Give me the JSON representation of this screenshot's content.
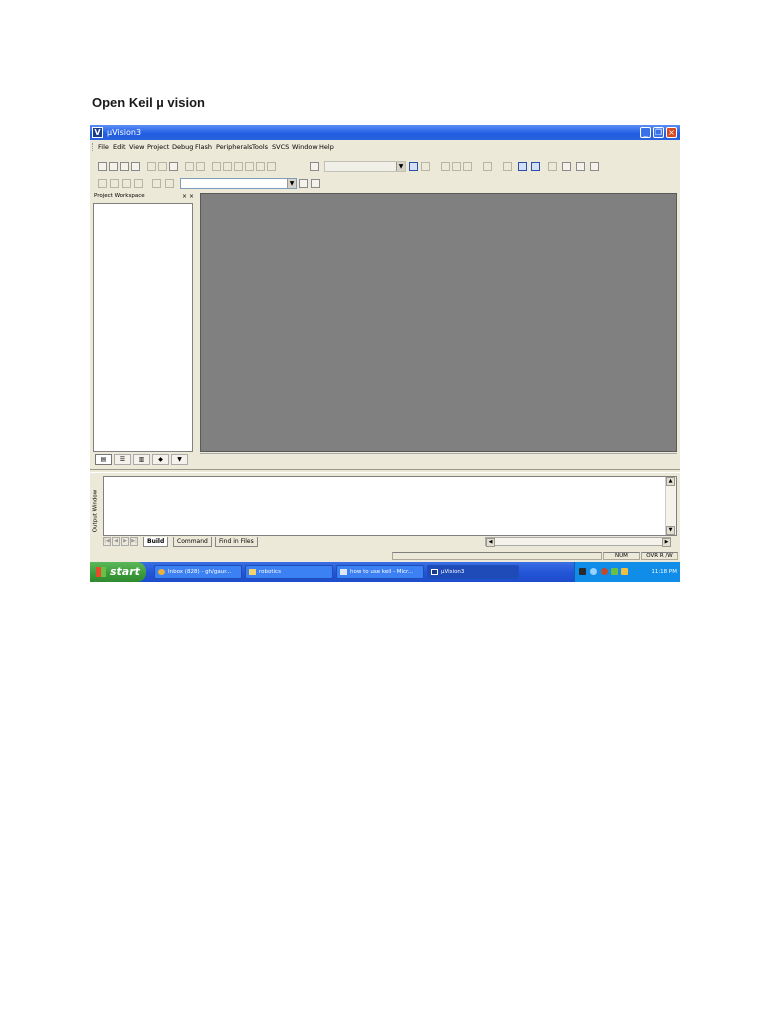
{
  "page": {
    "heading": "Open Keil µ vision"
  },
  "window": {
    "title": "µVision3",
    "icon_text": "V"
  },
  "menu": {
    "items": [
      "File",
      "Edit",
      "View",
      "Project",
      "Debug",
      "Flash",
      "Peripherals",
      "Tools",
      "SVCS",
      "Window",
      "Help"
    ]
  },
  "workspace": {
    "title": "Project Workspace",
    "close": "× ×"
  },
  "output": {
    "label": "Output Window",
    "tabs": {
      "build": "Build",
      "command": "Command",
      "find": "Find in Files"
    }
  },
  "status": {
    "num": "NUM",
    "ovr": "OVR R /W"
  },
  "taskbar": {
    "start": "start",
    "items": [
      {
        "label": "Inbox (828) - gh/gaur...",
        "icon": "chrome-icon"
      },
      {
        "label": "robotics",
        "icon": "folder-icon"
      },
      {
        "label": "how to use keil - Micr...",
        "icon": "word-icon"
      },
      {
        "label": "µVision3",
        "icon": "uvision-icon"
      }
    ],
    "clock": "11:18 PM"
  },
  "colors": {
    "titlebar": "#2b62de",
    "taskbar": "#2456d8",
    "start": "#3b9a3a",
    "mdi": "#808080"
  }
}
